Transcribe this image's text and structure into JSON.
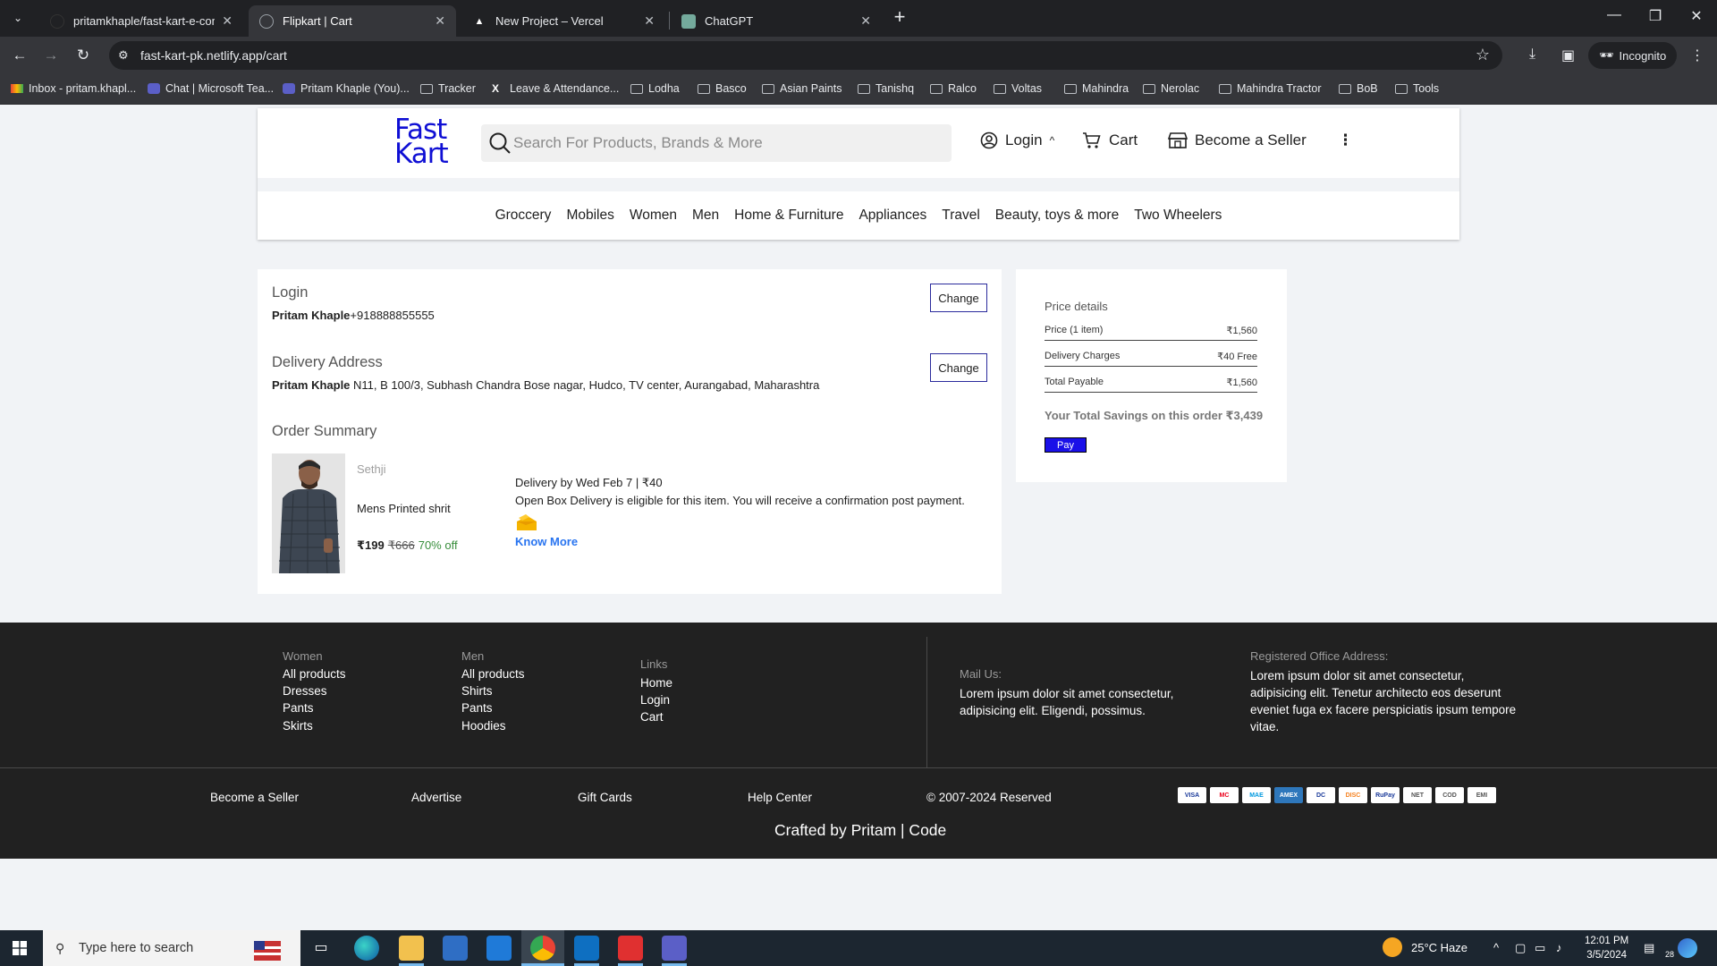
{
  "browser": {
    "tabs": [
      {
        "title": "pritamkhaple/fast-kart-e-comm",
        "active": false
      },
      {
        "title": "Flipkart | Cart",
        "active": true
      },
      {
        "title": "New Project – Vercel",
        "active": false
      },
      {
        "title": "ChatGPT",
        "active": false
      }
    ],
    "url": "fast-kart-pk.netlify.app/cart",
    "incognito_label": "Incognito",
    "bookmarks": [
      "Inbox - pritam.khapl...",
      "Chat | Microsoft Tea...",
      "Pritam Khaple (You)...",
      "Tracker",
      "Leave & Attendance...",
      "Lodha",
      "Basco",
      "Asian Paints",
      "Tanishq",
      "Ralco",
      "Voltas",
      "Mahindra",
      "Nerolac",
      "Mahindra Tractor",
      "BoB",
      "Tools"
    ]
  },
  "site": {
    "logo_line1": "Fast",
    "logo_line2": "Kart",
    "search_placeholder": "Search For Products, Brands & More",
    "login_label": "Login",
    "login_caret": "^",
    "cart_label": "Cart",
    "seller_label": "Become a Seller",
    "more_label": "⋮",
    "categories": [
      "Groccery",
      "Mobiles",
      "Women",
      "Men",
      "Home & Furniture",
      "Appliances",
      "Travel",
      "Beauty, toys & more",
      "Two Wheelers"
    ]
  },
  "checkout": {
    "login_title": "Login",
    "login_name": "Pritam Khaple",
    "login_phone": "+918888855555",
    "change_label": "Change",
    "address_title": "Delivery Address",
    "address_name": "Pritam Khaple",
    "address_text": " N11, B 100/3, Subhash Chandra Bose nagar, Hudco, TV center, Aurangabad, Maharashtra",
    "summary_title": "Order Summary",
    "product": {
      "brand": "Sethji",
      "name": "Mens Printed shrit",
      "price": "₹199",
      "mrp": "₹666",
      "discount": "70% off"
    },
    "delivery_info": "Delivery by Wed Feb 7 | ₹40",
    "open_box": "Open Box Delivery is eligible for this item. You will receive a confirmation post payment.",
    "know_more": "Know More"
  },
  "price_details": {
    "title": "Price details",
    "rows": [
      {
        "label": "Price (1 item)",
        "value": "₹1,560"
      },
      {
        "label": "Delivery Charges",
        "value": "₹40 Free"
      },
      {
        "label": "Total Payable",
        "value": "₹1,560"
      }
    ],
    "savings": "Your Total Savings on this order ₹3,439",
    "pay_label": "Pay"
  },
  "footer": {
    "women": {
      "heading": "Women",
      "links": [
        "All products",
        "Dresses",
        "Pants",
        "Skirts"
      ]
    },
    "men": {
      "heading": "Men",
      "links": [
        "All products",
        "Shirts",
        "Pants",
        "Hoodies"
      ]
    },
    "links": {
      "heading": "Links",
      "links": [
        "Home",
        "Login",
        "Cart"
      ]
    },
    "mail_heading": "Mail Us:",
    "mail_text": "Lorem ipsum dolor sit amet consectetur, adipisicing elit. Eligendi, possimus.",
    "office_heading": "Registered Office Address:",
    "office_text": "Lorem ipsum dolor sit amet consectetur, adipisicing elit. Tenetur architecto eos deserunt eveniet fuga ex facere perspiciatis ipsum tempore vitae.",
    "bottom_links": [
      "Become a Seller",
      "Advertise",
      "Gift Cards",
      "Help Center"
    ],
    "copyright": "© 2007-2024 Reserved",
    "crafted": "Crafted by Pritam | Code",
    "payment_cards": [
      "VISA",
      "MC",
      "MAE",
      "AMEX",
      "DC",
      "DISC",
      "RuPay",
      "NET",
      "COD",
      "EMI"
    ]
  },
  "taskbar": {
    "search_placeholder": "Type here to search",
    "weather": "25°C  Haze",
    "time": "12:01 PM",
    "date": "3/5/2024",
    "notif_count": "28"
  }
}
